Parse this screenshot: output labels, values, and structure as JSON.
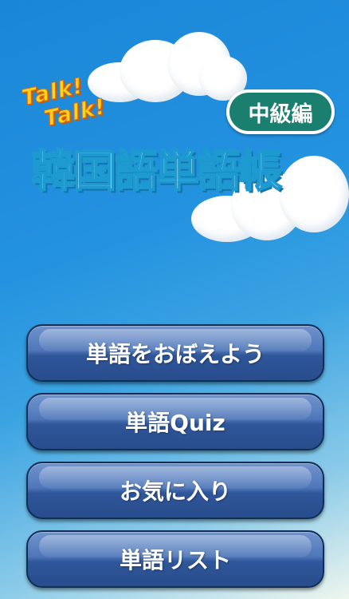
{
  "header": {
    "talk_line1": "Talk!",
    "talk_line2": "Talk!",
    "level_badge": "中級編",
    "app_title": "韓国語単語帳"
  },
  "menu": {
    "memorize": "単語をおぼえよう",
    "quiz": "単語Quiz",
    "favorites": "お気に入り",
    "word_list": "単語リスト"
  },
  "colors": {
    "sky": "#2392df",
    "button": "#3a62a6",
    "badge": "#1b7f6f",
    "talk_text": "#ffd21f"
  }
}
